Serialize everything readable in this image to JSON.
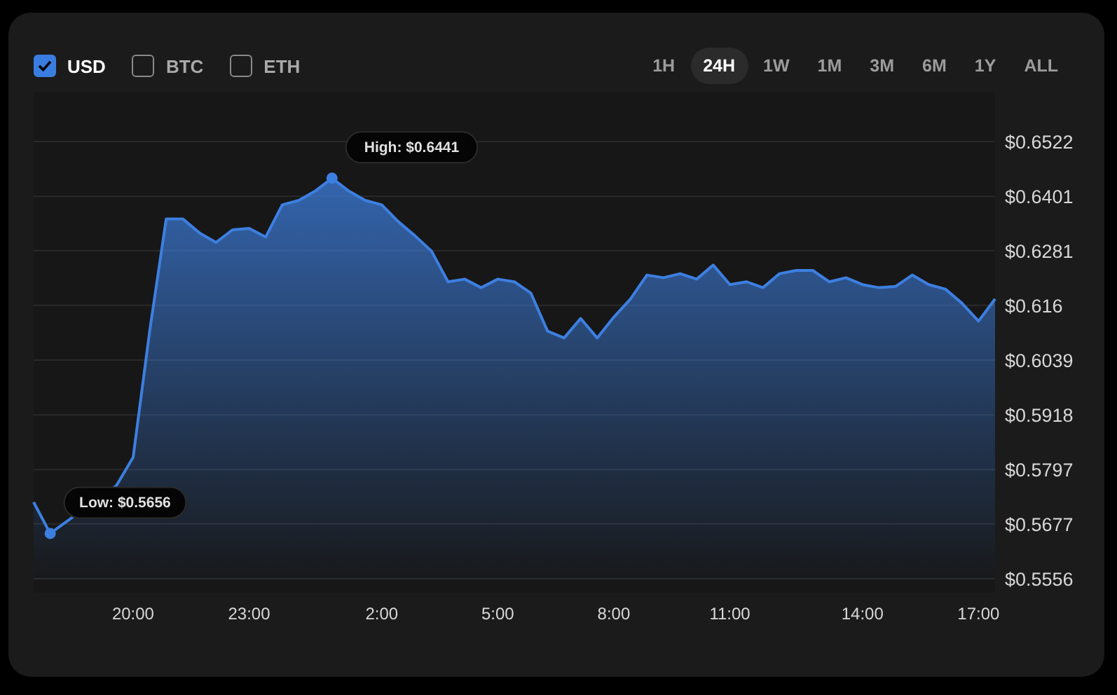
{
  "currencies": [
    {
      "label": "USD",
      "checked": true
    },
    {
      "label": "BTC",
      "checked": false
    },
    {
      "label": "ETH",
      "checked": false
    }
  ],
  "ranges": [
    {
      "label": "1H",
      "selected": false
    },
    {
      "label": "24H",
      "selected": true
    },
    {
      "label": "1W",
      "selected": false
    },
    {
      "label": "1M",
      "selected": false
    },
    {
      "label": "3M",
      "selected": false
    },
    {
      "label": "6M",
      "selected": false
    },
    {
      "label": "1Y",
      "selected": false
    },
    {
      "label": "ALL",
      "selected": false
    }
  ],
  "chart": {
    "chart_data": {
      "type": "area",
      "categories": [
        null,
        null,
        null,
        null,
        null,
        null,
        "20:00",
        null,
        null,
        null,
        null,
        null,
        null,
        "23:00",
        null,
        null,
        null,
        null,
        null,
        null,
        null,
        "2:00",
        null,
        null,
        null,
        null,
        null,
        null,
        "5:00",
        null,
        null,
        null,
        null,
        null,
        null,
        "8:00",
        null,
        null,
        null,
        null,
        null,
        null,
        "11:00",
        null,
        null,
        null,
        null,
        null,
        null,
        null,
        "14:00",
        null,
        null,
        null,
        null,
        null,
        null,
        "17:00",
        null
      ],
      "series": [
        {
          "color": "#3d7fe0",
          "values": [
            0.5725,
            0.5656,
            null,
            null,
            null,
            0.5762,
            0.5824,
            0.6103,
            0.6351,
            0.6351,
            0.632,
            0.6299,
            0.6327,
            0.633,
            0.6311,
            0.6382,
            0.6392,
            0.6413,
            0.6441,
            0.6413,
            0.6392,
            0.6382,
            0.6345,
            0.6314,
            0.628,
            0.6212,
            0.6218,
            0.6199,
            0.6218,
            0.6212,
            0.6187,
            0.6103,
            0.6088,
            0.6131,
            0.6088,
            0.6134,
            0.6174,
            0.6227,
            0.6221,
            0.623,
            0.6218,
            0.6249,
            0.6206,
            0.6212,
            0.6199,
            0.623,
            0.6237,
            0.6237,
            0.6212,
            0.6221,
            0.6206,
            0.6199,
            0.6202,
            0.6227,
            0.6206,
            0.6196,
            0.6165,
            0.6125,
            0.6174
          ]
        }
      ],
      "ylim": [
        0.5556,
        0.6522
      ],
      "grid": true,
      "yticks": [
        {
          "value": 0.6522,
          "label": "$0.6522"
        },
        {
          "value": 0.6401,
          "label": "$0.6401"
        },
        {
          "value": 0.6281,
          "label": "$0.6281"
        },
        {
          "value": 0.616,
          "label": "$0.616"
        },
        {
          "value": 0.6039,
          "label": "$0.6039"
        },
        {
          "value": 0.5918,
          "label": "$0.5918"
        },
        {
          "value": 0.5797,
          "label": "$0.5797"
        },
        {
          "value": 0.5677,
          "label": "$0.5677"
        },
        {
          "value": 0.5556,
          "label": "$0.5556"
        }
      ],
      "annotations": [
        "High: $0.6441",
        "Low: $0.5656"
      ]
    }
  }
}
